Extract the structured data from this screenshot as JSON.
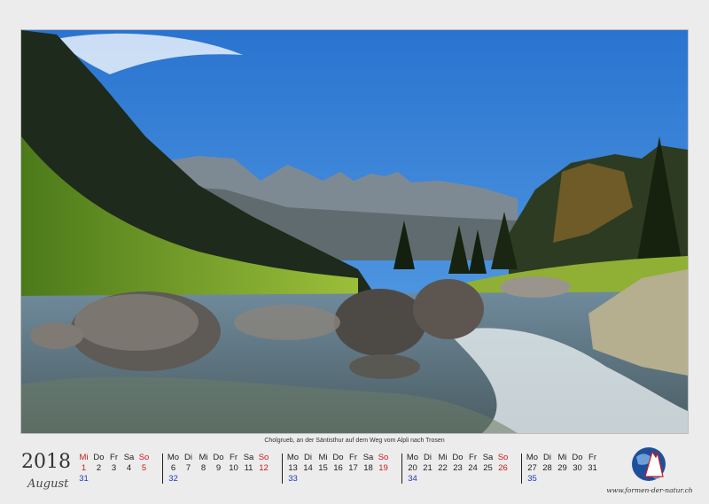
{
  "caption": "Cholgrueb, an der Säntisthur auf dem Weg vom Alpli nach Trosen",
  "year": "2018",
  "month": "August",
  "site": "www.formen-der-natur.ch",
  "weeks": [
    {
      "week": "31",
      "days": [
        [
          "Mi",
          "1"
        ],
        [
          "Do",
          "2"
        ],
        [
          "Fr",
          "3"
        ],
        [
          "Sa",
          "4"
        ],
        [
          "So",
          "5"
        ]
      ],
      "red": [
        "Mi",
        "So"
      ],
      "offset": 0
    },
    {
      "week": "32",
      "days": [
        [
          "Mo",
          "6"
        ],
        [
          "Di",
          "7"
        ],
        [
          "Mi",
          "8"
        ],
        [
          "Do",
          "9"
        ],
        [
          "Fr",
          "10"
        ],
        [
          "Sa",
          "11"
        ],
        [
          "So",
          "12"
        ]
      ],
      "red": [
        "So"
      ],
      "offset": 1
    },
    {
      "week": "33",
      "days": [
        [
          "Mo",
          "13"
        ],
        [
          "Di",
          "14"
        ],
        [
          "Mi",
          "15"
        ],
        [
          "Do",
          "16"
        ],
        [
          "Fr",
          "17"
        ],
        [
          "Sa",
          "18"
        ],
        [
          "So",
          "19"
        ]
      ],
      "red": [
        "So"
      ],
      "offset": 2
    },
    {
      "week": "34",
      "days": [
        [
          "Mo",
          "20"
        ],
        [
          "Di",
          "21"
        ],
        [
          "Mi",
          "22"
        ],
        [
          "Do",
          "23"
        ],
        [
          "Fr",
          "24"
        ],
        [
          "Sa",
          "25"
        ],
        [
          "So",
          "26"
        ]
      ],
      "red": [
        "So"
      ],
      "offset": 3
    },
    {
      "week": "35",
      "days": [
        [
          "Mo",
          "27"
        ],
        [
          "Di",
          "28"
        ],
        [
          "Mi",
          "29"
        ],
        [
          "Do",
          "30"
        ],
        [
          "Fr",
          "31"
        ]
      ],
      "red": [],
      "offset": 4
    }
  ],
  "colors": {
    "red": "#d01818",
    "weeknum": "#1f3ac2",
    "sky": "#2f7fd6"
  }
}
